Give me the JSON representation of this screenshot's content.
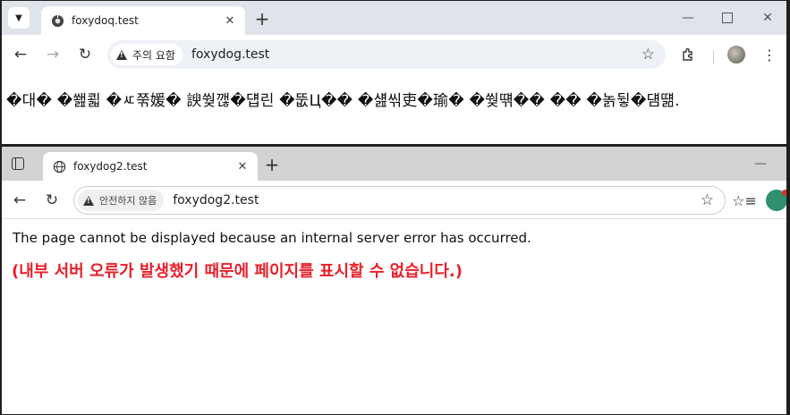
{
  "window1": {
    "tab": {
      "title": "foxydoq.test"
    },
    "omnibox": {
      "security_chip": "주의 요함",
      "url": "foxydog.test"
    },
    "content": {
      "garbled_text": "�대� �쐞쾳 �ㅼ쭊媛� 諛쒖깮�덉린 �뚮Ц�� �섎씪吏�瑜� �쒖떆�� �� �놁뒿�덈떎."
    },
    "icons": [
      "tab-list-icon",
      "globe-icon",
      "close-icon",
      "plus-icon",
      "minimize-icon",
      "maximize-icon",
      "close-window-icon",
      "back-arrow-icon",
      "forward-arrow-icon",
      "reload-icon",
      "warning-icon",
      "star-icon",
      "extensions-icon",
      "more-vert-icon"
    ]
  },
  "window2": {
    "tab": {
      "title": "foxydog2.test"
    },
    "omnibox": {
      "security_chip": "안전하지 않음",
      "url": "foxydog2.test"
    },
    "content": {
      "error_en": "The page cannot be displayed because an internal server error has occurred.",
      "error_ko": "(내부 서버 오류가 발생했기 때문에 페이지를 표시할 수 없습니다.)"
    },
    "colors": {
      "error_ko": "#e8202a"
    },
    "icons": [
      "sidebar-icon",
      "globe-icon",
      "close-icon",
      "plus-icon",
      "minimize-icon",
      "back-arrow-icon",
      "reload-icon",
      "warning-icon",
      "star-icon",
      "favorites-icon"
    ]
  }
}
